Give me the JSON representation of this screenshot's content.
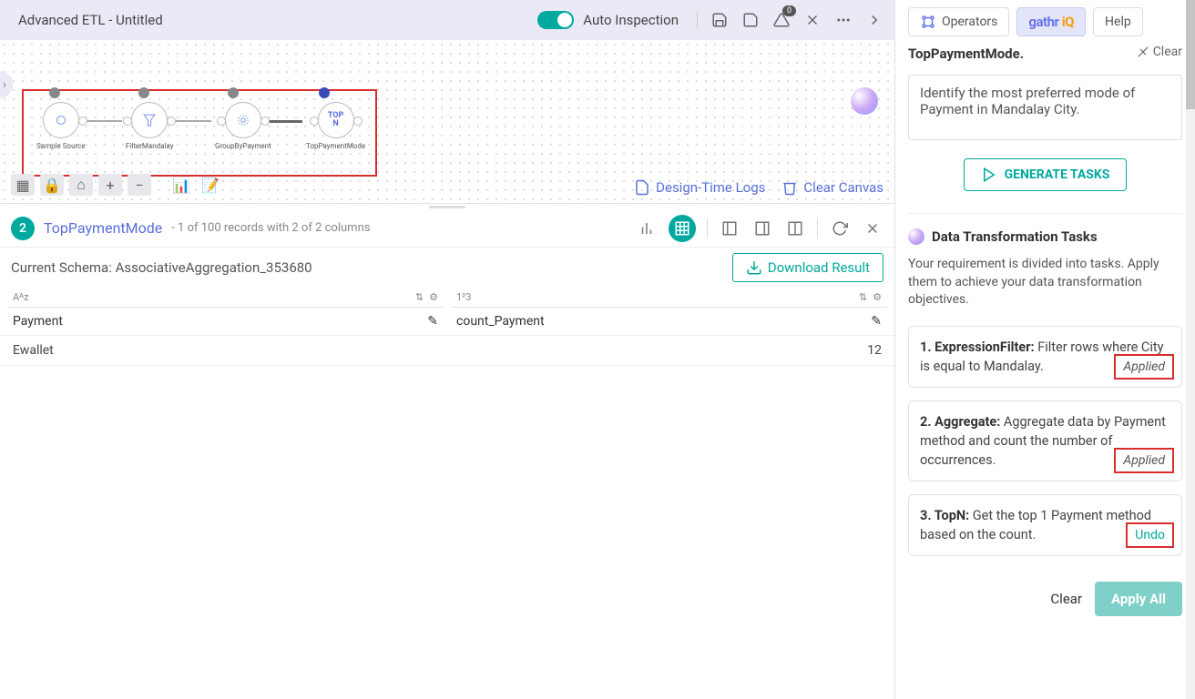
{
  "header": {
    "title": "Advanced ETL - Untitled",
    "auto_inspection": "Auto Inspection",
    "badge": "0"
  },
  "canvas": {
    "nodes": [
      {
        "label": "Sample Source"
      },
      {
        "label": "FilterMandalay"
      },
      {
        "label": "GroupByPayment"
      },
      {
        "label": "TopPaymentMode"
      }
    ],
    "links": {
      "design_logs": "Design-Time Logs",
      "clear_canvas": "Clear Canvas"
    }
  },
  "data": {
    "step_number": "2",
    "step_title": "TopPaymentMode",
    "step_sub": "- 1 of 100 records with 2 of 2 columns",
    "schema_label": "Current Schema:",
    "schema_value": "AssociativeAggregation_353680",
    "download": "Download Result",
    "columns": [
      {
        "type": "Aᴬz",
        "name": "Payment"
      },
      {
        "type": "1²3",
        "name": "count_Payment"
      }
    ],
    "rows": [
      {
        "c0": "Ewallet",
        "c1": "12"
      }
    ]
  },
  "sidepanel": {
    "tabs": {
      "operators": "Operators",
      "help": "Help"
    },
    "title": "TopPaymentMode",
    "clear": "Clear",
    "prompt": "Identify the most preferred mode of Payment in Mandalay City.",
    "generate": "GENERATE TASKS",
    "section_title": "Data Transformation Tasks",
    "section_desc": "Your requirement is divided into tasks. Apply them to achieve your data transformation objectives.",
    "tasks": [
      {
        "n": "1.",
        "name": "ExpressionFilter:",
        "text": " Filter rows where City is equal to Mandalay.",
        "status": "Applied",
        "status_class": ""
      },
      {
        "n": "2.",
        "name": "Aggregate:",
        "text": " Aggregate data by Payment method and count the number of occurrences.",
        "status": "Applied",
        "status_class": ""
      },
      {
        "n": "3.",
        "name": "TopN:",
        "text": " Get the top 1 Payment method based on the count.",
        "status": "Undo",
        "status_class": "undo"
      }
    ],
    "footer": {
      "clear": "Clear",
      "apply": "Apply All"
    }
  }
}
